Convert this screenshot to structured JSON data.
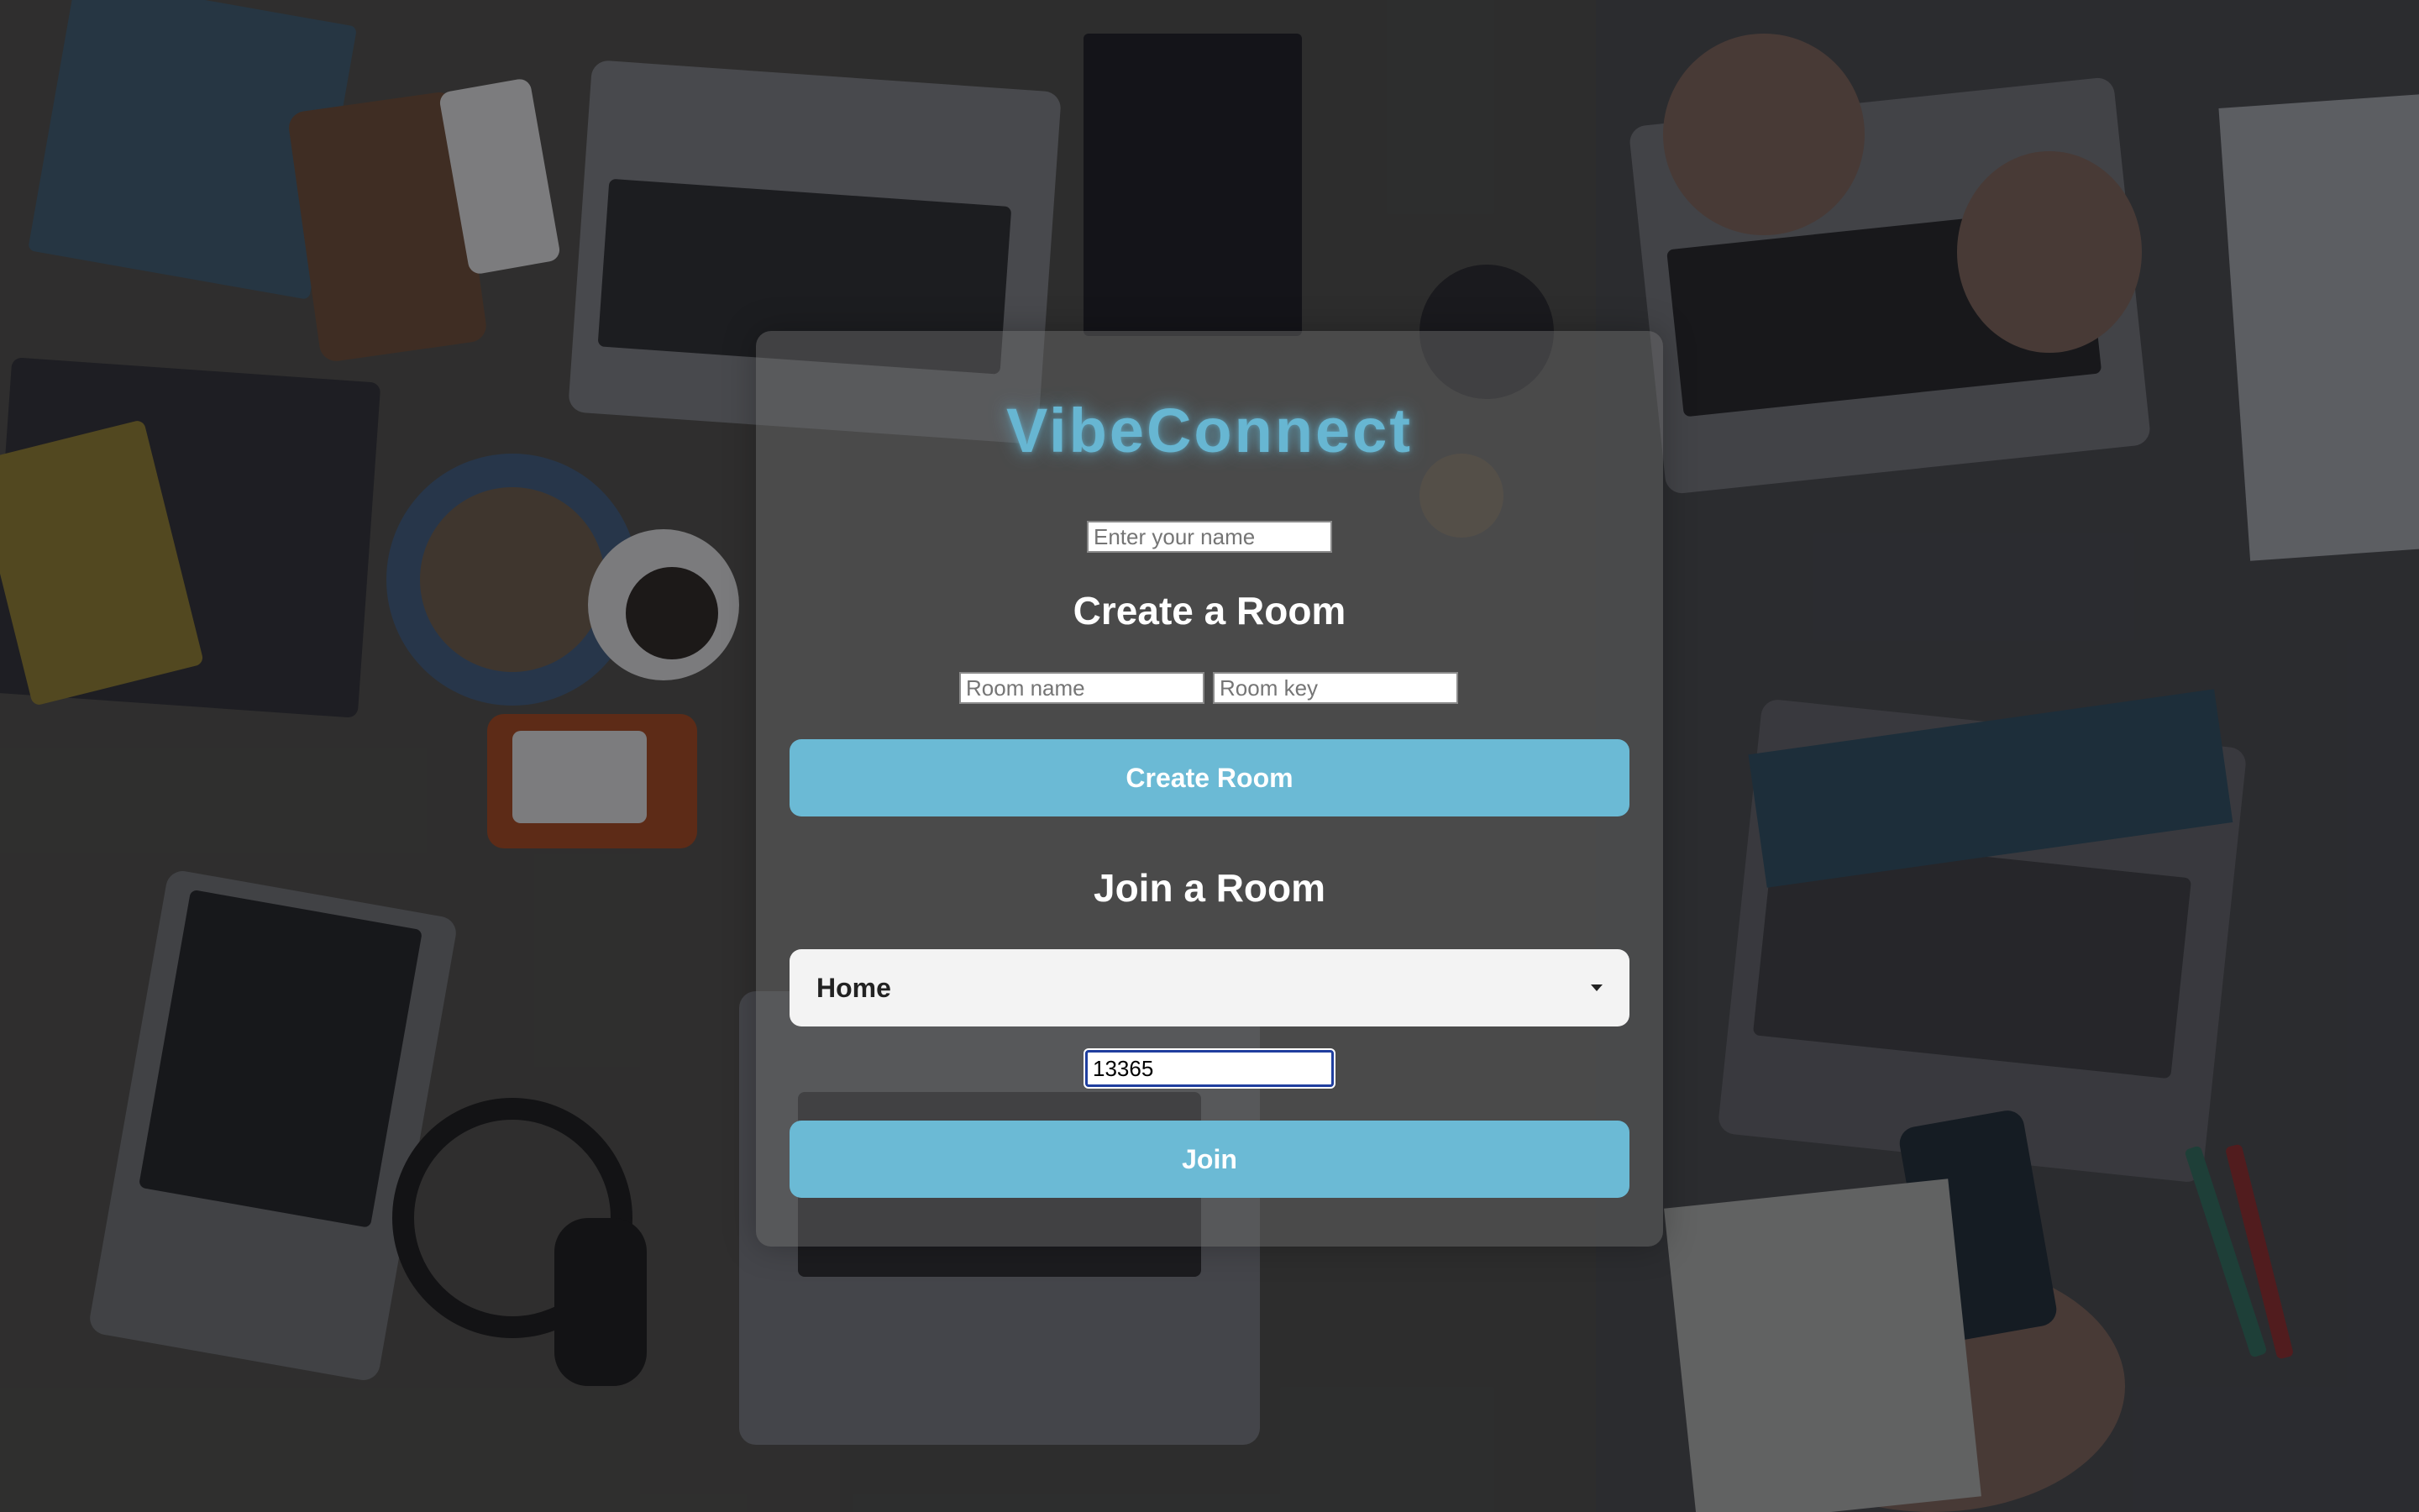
{
  "app": {
    "title": "VibeConnect"
  },
  "name_field": {
    "placeholder": "Enter your name",
    "value": ""
  },
  "create_room": {
    "heading": "Create a Room",
    "room_name_placeholder": "Room name",
    "room_key_placeholder": "Room key",
    "button_label": "Create Room"
  },
  "join_room": {
    "heading": "Join a Room",
    "selected_room": "Home",
    "key_value": "13365",
    "button_label": "Join"
  },
  "colors": {
    "accent": "#6bbad5",
    "brand_glow": "#67b6d2",
    "focus_ring": "#1f3e9e"
  },
  "icons": {
    "dropdown": "caret-down-icon"
  }
}
